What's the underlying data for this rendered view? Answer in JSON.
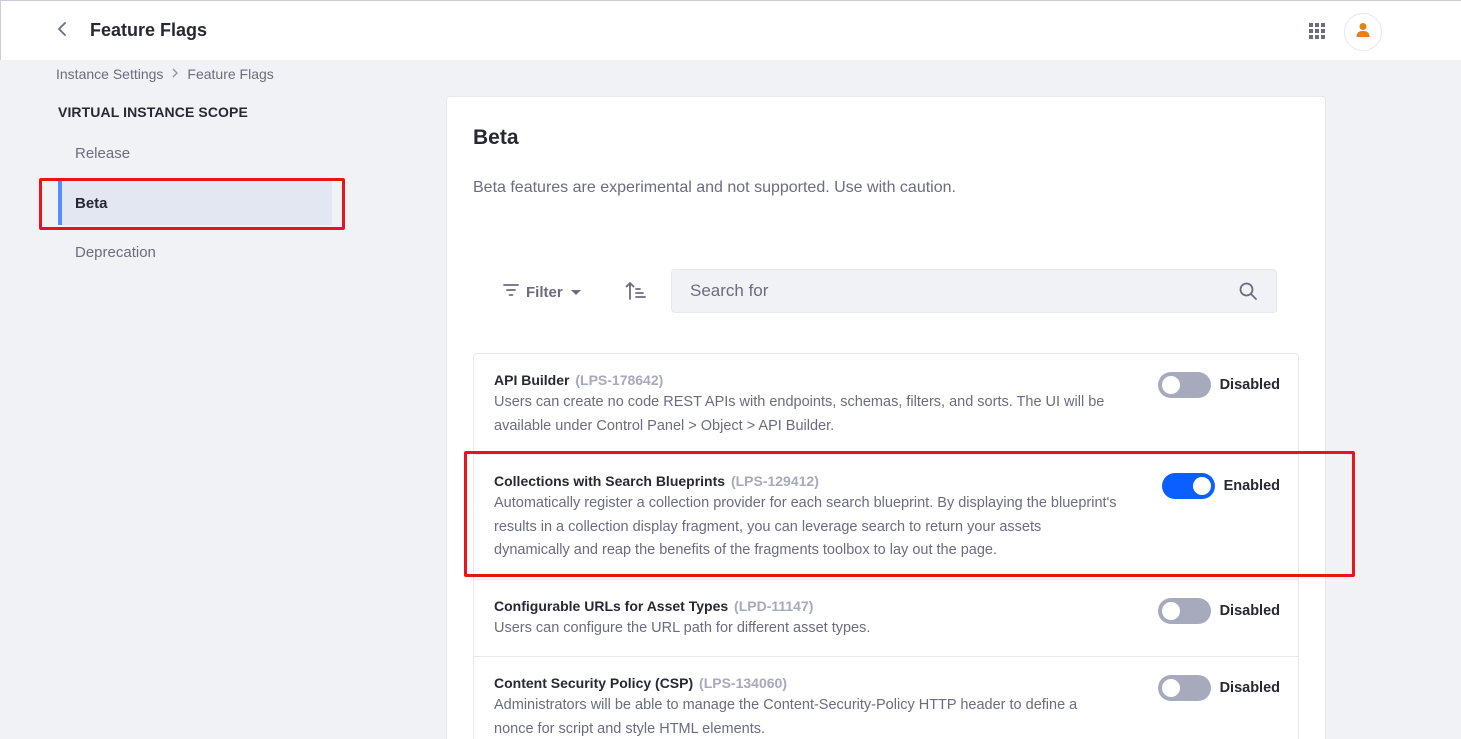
{
  "header": {
    "title": "Feature Flags",
    "back_icon": "chevron-left-icon",
    "apps_icon": "grid-icon",
    "avatar_icon": "user-icon",
    "avatar_color": "#e67e22"
  },
  "breadcrumb": {
    "items": [
      "Instance Settings",
      "Feature Flags"
    ]
  },
  "sidebar": {
    "scope_title": "VIRTUAL INSTANCE SCOPE",
    "items": [
      {
        "label": "Release",
        "active": false
      },
      {
        "label": "Beta",
        "active": true
      },
      {
        "label": "Deprecation",
        "active": false
      }
    ]
  },
  "main": {
    "title": "Beta",
    "description": "Beta features are experimental and not supported. Use with caution.",
    "toolbar": {
      "filter_label": "Filter",
      "search_placeholder": "Search for"
    },
    "flags": [
      {
        "name": "API Builder",
        "key": "(LPS-178642)",
        "description": "Users can create no code REST APIs with endpoints, schemas, filters, and sorts. The UI will be available under Control Panel > Object > API Builder.",
        "enabled": false,
        "status_label": "Disabled"
      },
      {
        "name": "Collections with Search Blueprints",
        "key": "(LPS-129412)",
        "description": "Automatically register a collection provider for each search blueprint. By displaying the blueprint's results in a collection display fragment, you can leverage search to return your assets dynamically and reap the benefits of the fragments toolbox to lay out the page.",
        "enabled": true,
        "status_label": "Enabled"
      },
      {
        "name": "Configurable URLs for Asset Types",
        "key": "(LPD-11147)",
        "description": "Users can configure the URL path for different asset types.",
        "enabled": false,
        "status_label": "Disabled"
      },
      {
        "name": "Content Security Policy (CSP)",
        "key": "(LPS-134060)",
        "description": "Administrators will be able to manage the Content-Security-Policy HTTP header to define a nonce for script and style HTML elements.",
        "enabled": false,
        "status_label": "Disabled"
      }
    ]
  },
  "colors": {
    "accent": "#0b5fff",
    "highlight": "#e8141c",
    "toggle_off": "#a7a9bc"
  }
}
